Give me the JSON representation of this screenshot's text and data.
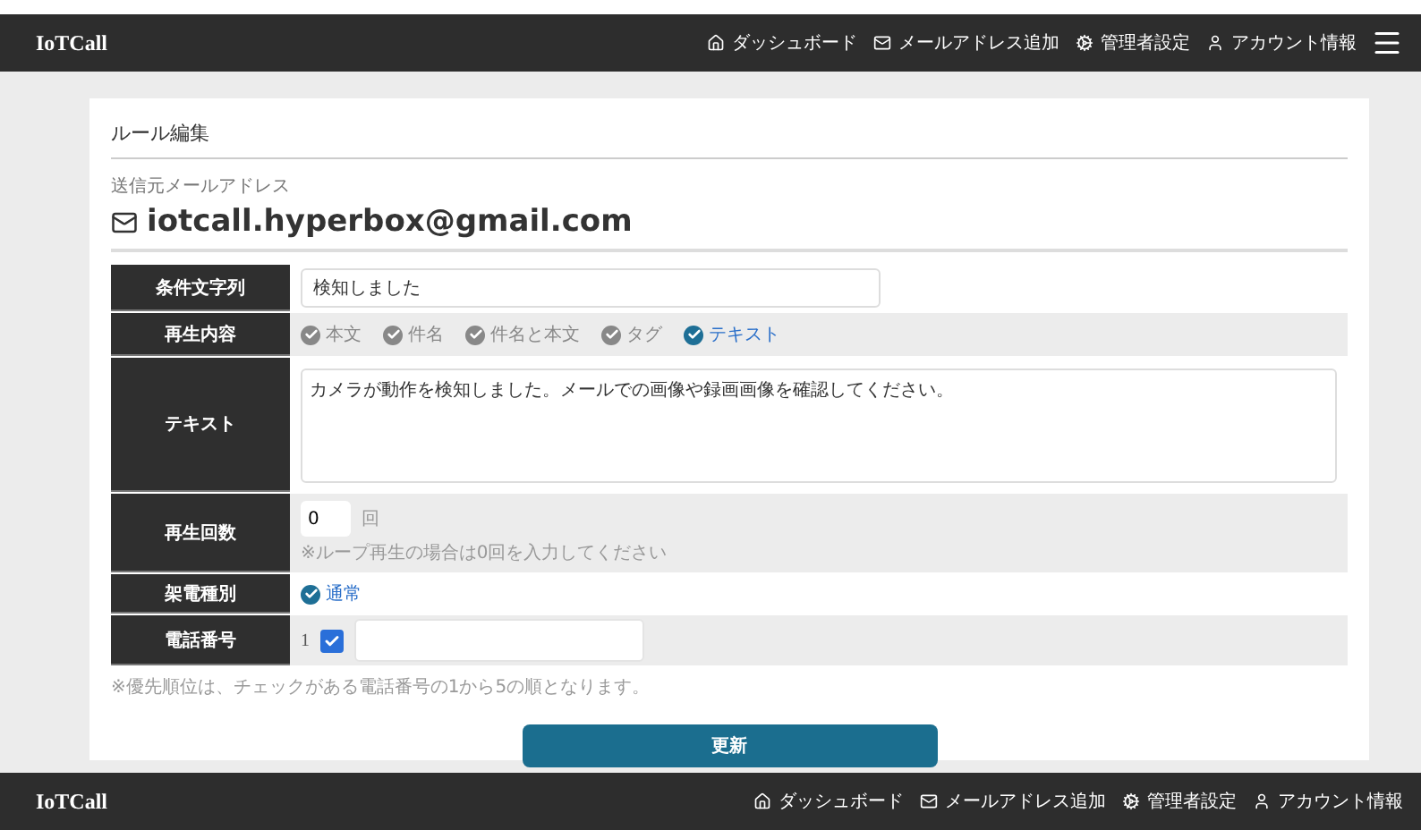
{
  "navbar": {
    "brand": "IoTCall",
    "items": [
      {
        "label": "ダッシュボード"
      },
      {
        "label": "メールアドレス追加"
      },
      {
        "label": "管理者設定"
      },
      {
        "label": "アカウント情報"
      }
    ]
  },
  "card": {
    "title": "ルール編集",
    "sender_label": "送信元メールアドレス",
    "sender_email": "iotcall.hyperbox@gmail.com",
    "rows": [
      {
        "kind": "input",
        "label": "条件文字列",
        "value": "検知しました"
      },
      {
        "kind": "radios",
        "label": "再生内容",
        "options": [
          {
            "label": "本文",
            "selected": false
          },
          {
            "label": "件名",
            "selected": false
          },
          {
            "label": "件名と本文",
            "selected": false
          },
          {
            "label": "タグ",
            "selected": false
          },
          {
            "label": "テキスト",
            "selected": true
          }
        ]
      },
      {
        "kind": "textarea",
        "label": "テキスト",
        "value": "カメラが動作を検知しました。メールでの画像や録画画像を確認してください。"
      },
      {
        "kind": "count",
        "label": "再生回数",
        "value": "0",
        "unit": "回",
        "hint": "※ループ再生の場合は0回を入力してください"
      },
      {
        "kind": "radios",
        "label": "架電種別",
        "options": [
          {
            "label": "通常",
            "selected": true
          }
        ]
      },
      {
        "kind": "phone",
        "label": "電話番号",
        "phones": [
          {
            "index": "1",
            "checked": true
          }
        ]
      }
    ],
    "note": "※優先順位は、チェックがある電話番号の1から5の順となります。",
    "button": "更新"
  },
  "footer": {
    "brand": "IoTCall",
    "items": [
      {
        "label": "ダッシュボード"
      },
      {
        "label": "メールアドレス追加"
      },
      {
        "label": "管理者設定"
      },
      {
        "label": "アカウント情報"
      }
    ]
  }
}
